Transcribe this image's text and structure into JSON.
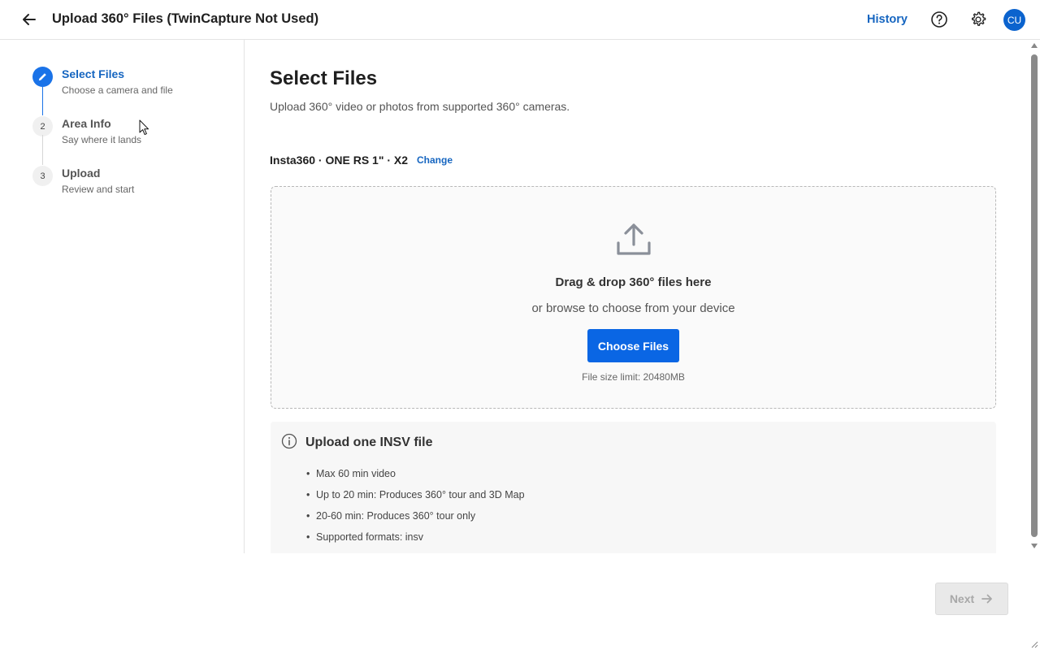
{
  "header": {
    "title": "Upload 360° Files (TwinCapture Not Used)",
    "history_label": "History",
    "avatar_initials": "CU",
    "icons": {
      "back": "arrow-left-icon",
      "help": "help-circle-icon",
      "settings": "gear-icon"
    }
  },
  "sidebar": {
    "steps": [
      {
        "number": "",
        "title": "Select Files",
        "subtitle": "Choose a camera and file",
        "state": "active",
        "icon": "pencil-icon"
      },
      {
        "number": "2",
        "title": "Area Info",
        "subtitle": "Say where it lands",
        "state": "pending"
      },
      {
        "number": "3",
        "title": "Upload",
        "subtitle": "Review and start",
        "state": "pending"
      }
    ]
  },
  "main": {
    "title": "Select Files",
    "subtitle": "Upload 360° video or photos from supported 360° cameras.",
    "camera": {
      "name": "Insta360 · ONE RS 1\" · X2",
      "change_label": "Change"
    },
    "dropzone": {
      "title": "Drag & drop 360° files here",
      "subtitle": "or browse to choose from your device",
      "button_label": "Choose Files",
      "size_limit": "File size limit: 20480MB"
    },
    "info": {
      "title": "Upload one INSV file",
      "items": [
        "Max 60 min video",
        "Up to 20 min: Produces 360° tour and 3D Map",
        "20-60 min: Produces 360° tour only",
        "Supported formats: insv"
      ]
    }
  },
  "footer": {
    "next_label": "Next",
    "next_enabled": false
  },
  "colors": {
    "accent": "#1a73e8",
    "link": "#1565c0",
    "button": "#0a66e4",
    "avatar": "#0b63ce",
    "disabled": "#a8a8a8"
  }
}
